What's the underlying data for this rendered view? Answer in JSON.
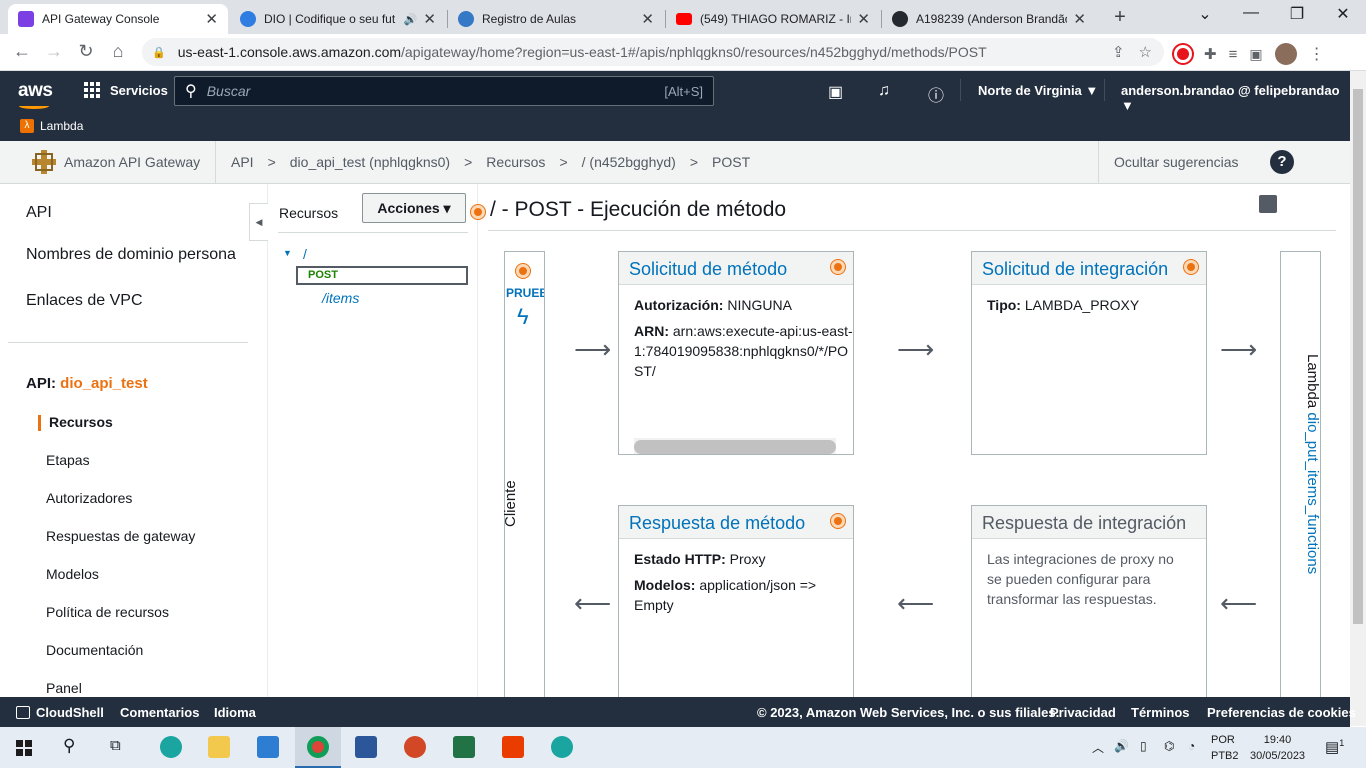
{
  "browser": {
    "tabs": [
      {
        "title": "API Gateway Console",
        "color": "#7b3fe4"
      },
      {
        "title": "DIO | Codifique o seu fut",
        "color": "#2f7de1"
      },
      {
        "title": "Registro de Aulas",
        "color": "#3478c6"
      },
      {
        "title": "(549) THIAGO ROMARIZ - Int",
        "color": "#ff0000"
      },
      {
        "title": "A198239 (Anderson Brandão",
        "color": "#24292f"
      }
    ],
    "url_host": "us-east-1.console.aws.amazon.com",
    "url_rest": "/apigateway/home?region=us-east-1#/apis/nphlqgkns0/resources/n452bgghyd/methods/POST"
  },
  "aws_nav": {
    "services": "Servicios",
    "search_placeholder": "Buscar",
    "search_shortcut": "[Alt+S]",
    "region": "Norte de Virginia ▼",
    "account": "anderson.brandao @ felipebrandao ▼",
    "favorite": "Lambda"
  },
  "breadcrumb": {
    "service": "Amazon API Gateway",
    "items": [
      "API",
      "dio_api_test (nphlqgkns0)",
      "Recursos",
      "/ (n452bgghyd)",
      "POST"
    ],
    "separator": ">",
    "hide_tips": "Ocultar sugerencias",
    "help": "?"
  },
  "left_nav": {
    "top_items": [
      "API",
      "Nombres de dominio persona",
      "Enlaces de VPC"
    ],
    "api_label": "API:",
    "api_name": "dio_api_test",
    "sub_items": [
      "Recursos",
      "Etapas",
      "Autorizadores",
      "Respuestas de gateway",
      "Modelos",
      "Política de recursos",
      "Documentación",
      "Panel"
    ]
  },
  "resources": {
    "title": "Recursos",
    "actions": "Acciones ▾",
    "root": "/",
    "method": "POST",
    "child": "/items"
  },
  "main": {
    "title": "/ - POST - Ejecución de método",
    "client_test": "PRUEBA",
    "client_label": "Cliente",
    "lambda_label": "Lambda",
    "lambda_fn": "dio_put_items_functions",
    "method_request": {
      "title": "Solicitud de método",
      "auth_label": "Autorización:",
      "auth_value": "NINGUNA",
      "arn_label": "ARN:",
      "arn_value": "arn:aws:execute-api:us-east-1:784019095838:nphlqgkns0/*/POST/"
    },
    "integration_request": {
      "title": "Solicitud de integración",
      "type_label": "Tipo:",
      "type_value": "LAMBDA_PROXY"
    },
    "method_response": {
      "title": "Respuesta de método",
      "status_label": "Estado HTTP:",
      "status_value": "Proxy",
      "models_label": "Modelos:",
      "models_value": "application/json => Empty"
    },
    "integration_response": {
      "title": "Respuesta de integración",
      "note": "Las integraciones de proxy no se pueden configurar para transformar las respuestas."
    }
  },
  "footer": {
    "cloudshell": "CloudShell",
    "feedback": "Comentarios",
    "language": "Idioma",
    "copyright": "© 2023, Amazon Web Services, Inc. o sus filiales.",
    "privacy": "Privacidad",
    "terms": "Términos",
    "cookies": "Preferencias de cookies"
  },
  "taskbar": {
    "lang1": "POR",
    "lang2": "PTB2",
    "time": "19:40",
    "date": "30/05/2023",
    "notifications": "1"
  },
  "colors": {
    "aws_nav": "#232f3e",
    "accent_orange": "#ec7211",
    "link_blue": "#0073bb"
  }
}
